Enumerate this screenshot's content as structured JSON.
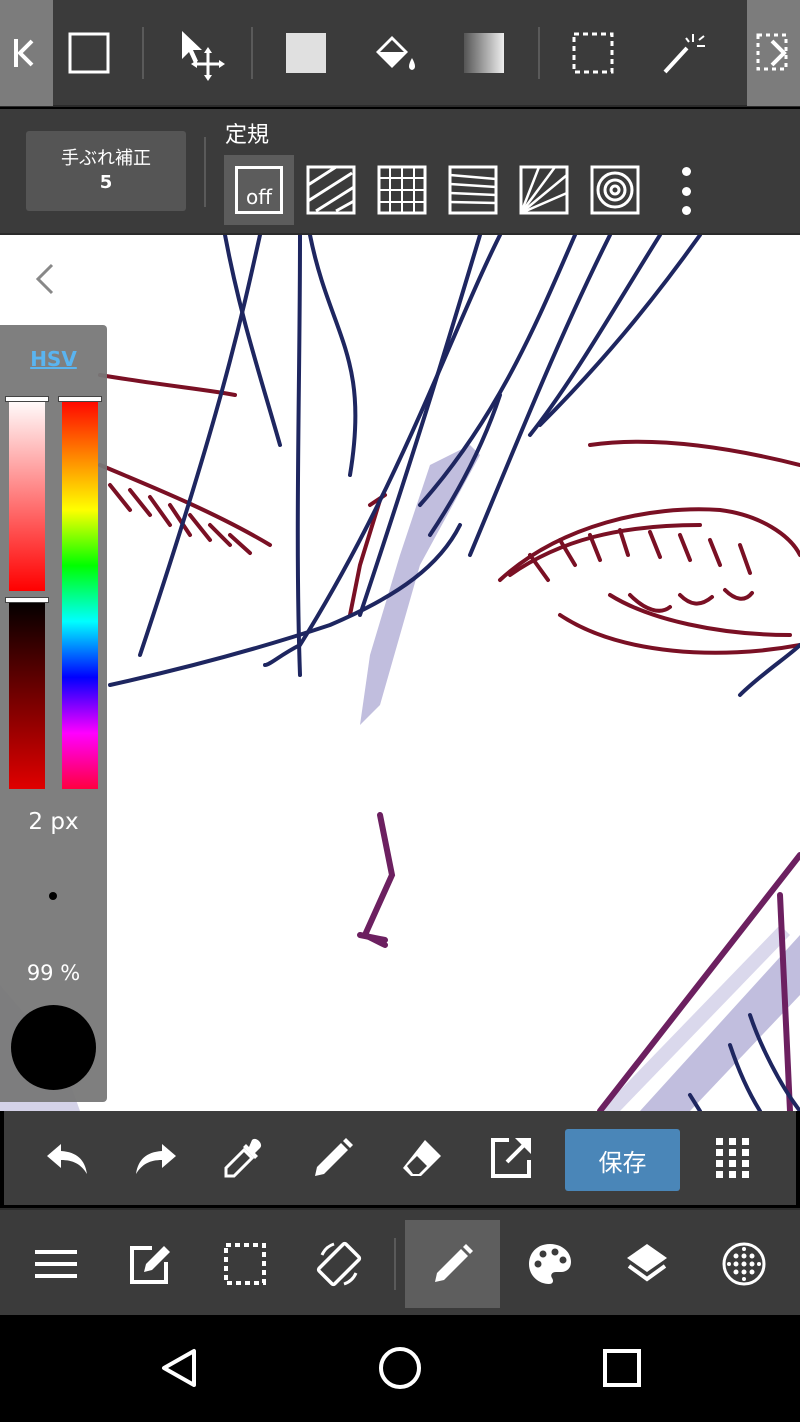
{
  "top_toolbar": {
    "tools": [
      "brush-icon",
      "square-fill-icon",
      "move-transform-icon",
      "fill-rect-icon",
      "bucket-fill-icon",
      "gradient-icon",
      "select-rect-icon",
      "magic-wand-icon",
      "select-pen-icon"
    ]
  },
  "stabilizer": {
    "label": "手ぶれ補正",
    "value": "5"
  },
  "ruler": {
    "title": "定規",
    "off_label": "off"
  },
  "color_panel": {
    "mode": "HSV",
    "brush_size": "2 px",
    "opacity": "99 %",
    "current_color": "#000000"
  },
  "action_bar": {
    "save_label": "保存"
  },
  "colors": {
    "toolbar_bg": "#3b3b3b",
    "save_accent": "#4a86b8",
    "hsv_link": "#5ab4f0"
  }
}
